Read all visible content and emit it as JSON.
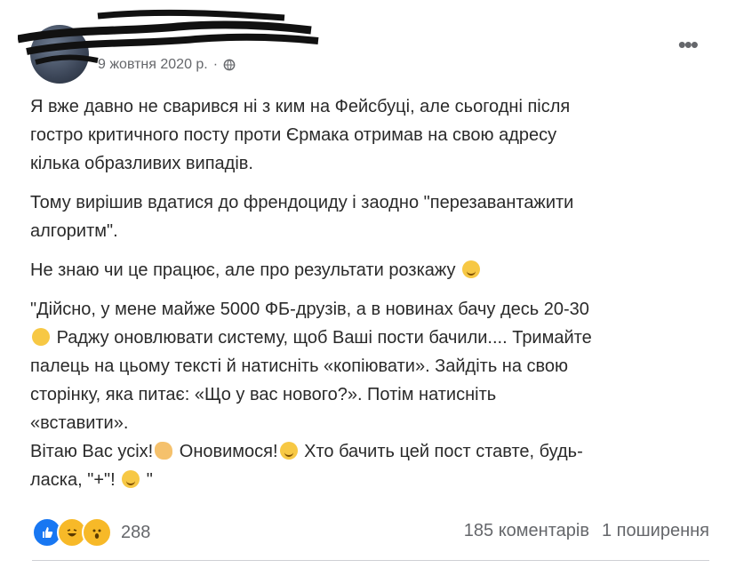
{
  "post": {
    "date": "9 жовтня 2020 р.",
    "separator": "·",
    "paragraphs": [
      "Я вже давно не сварився ні з ким на Фейсбуці, але сьогодні після\nгостро критичного посту проти Єрмака отримав на свою адресу\nкілька образливих випадів.",
      "Тому вирішив вдатися до френдоциду і заодно \"перезавантажити\nалгоритм\".",
      "Не знаю чи це працює, але про результати розкажу"
    ],
    "quote": {
      "part1": "\"Дійсно, у мене майже 5000 ФБ-друзів, а в новинах бачу десь 20-30",
      "part2": "Раджу оновлювати систему, щоб Ваші пости бачили.... Тримайте\nпалець на цьому тексті й натисніть «копіювати». Зайдіть на свою\nсторінку, яка питає: «Що у вас нового?». Потім натисніть\n«вставити».",
      "part3": "Вітаю Вас усіх!",
      "part4": "Оновимося!",
      "part5": "Хто бачить цей пост ставте, будь-\nласка, \"+\"!",
      "part6": "\""
    }
  },
  "footer": {
    "reaction_count": "288",
    "comments": "185 коментарів",
    "shares": "1 поширення"
  },
  "icons": {
    "more": "more-options-icon",
    "globe": "globe-icon",
    "like": "like-reaction-icon",
    "haha": "haha-reaction-icon",
    "wow": "wow-reaction-icon"
  }
}
